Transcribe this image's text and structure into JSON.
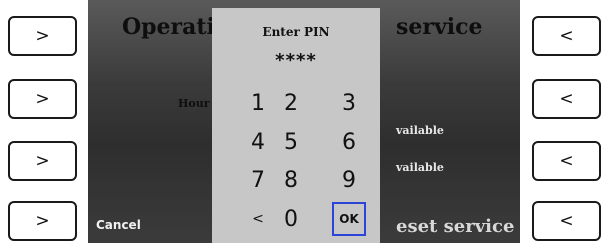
{
  "screen": {
    "title_left": "Operati",
    "title_right": "service",
    "hour_label": "Hour",
    "available_1": "vailable",
    "available_2": "vailable",
    "reset_label": "eset service",
    "cancel_label": "Cancel"
  },
  "side_buttons": {
    "left": [
      ">",
      ">",
      ">",
      ">"
    ],
    "right": [
      "<",
      "<",
      "<",
      "<"
    ]
  },
  "pin_dialog": {
    "title": "Enter PIN",
    "masked_value": "****",
    "keys": [
      "1",
      "2",
      "3",
      "4",
      "5",
      "6",
      "7",
      "8",
      "9",
      "<",
      "0",
      "OK"
    ]
  },
  "colors": {
    "ok_border": "#2b46d6",
    "panel_background": "#c7c7c7"
  }
}
